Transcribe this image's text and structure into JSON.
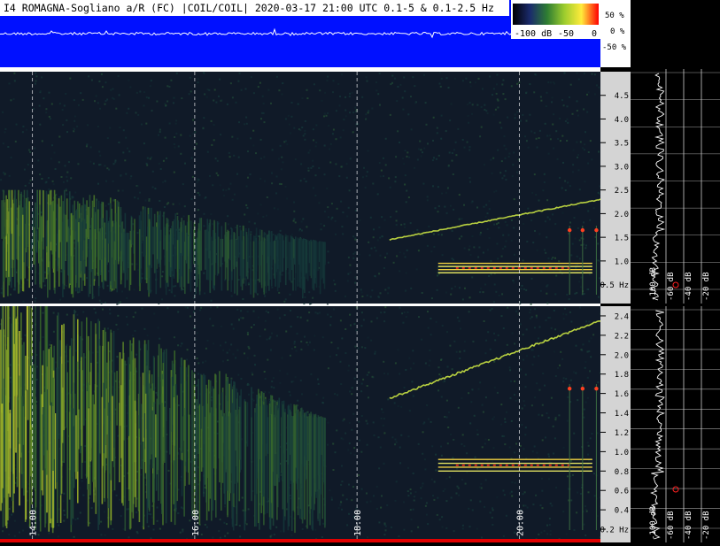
{
  "header": {
    "title": "I4 ROMAGNA-Sogliano a/R (FC) |COIL/COIL| 2020-03-17 21:00 UTC 0.1-5 & 0.1-2.5  Hz"
  },
  "colorbar": {
    "labels": [
      "-100 dB",
      "-50",
      "0"
    ],
    "colors": [
      "#000000",
      "#1a2a6c",
      "#2e7d32",
      "#9ccc2e",
      "#ffeb3b",
      "#ff0000"
    ]
  },
  "waveform_scale": [
    "50 %",
    "0 %",
    "-50 %"
  ],
  "time_axis": {
    "labels": [
      "14:00",
      "16:00",
      "18:00",
      "20:00"
    ],
    "positions_hours": [
      14,
      16,
      18,
      20
    ],
    "start_hour": 13.6,
    "end_hour": 21.0
  },
  "spectrum_axis_labels": [
    "-100 dB",
    "-60 dB",
    "-40 dB",
    "-20 dB"
  ],
  "chart_data": [
    {
      "type": "heatmap",
      "title": "I4 ROMAGNA-Sogliano a/R (FC) |COIL/COIL| 2020-03-17 21:00 UTC 0.1-5 & 0.1-2.5  Hz",
      "xlabel": "",
      "ylabel": "",
      "x_range_hours": [
        13.6,
        21.0
      ],
      "ylim": [
        0.1,
        5.0
      ],
      "y_ticks": [
        0.5,
        1.0,
        1.5,
        2.0,
        2.5,
        3.0,
        3.5,
        4.0,
        4.5
      ],
      "y_tick_labels": [
        "0.5 Hz",
        "1.0",
        "1.5",
        "2.0",
        "2.5",
        "3.0",
        "3.5",
        "4.0",
        "4.5"
      ],
      "features": [
        {
          "kind": "broadband",
          "t": [
            13.6,
            17.6
          ],
          "f": [
            0.3,
            2.5
          ],
          "intensity": 0.7
        },
        {
          "kind": "rising-line",
          "t": [
            18.4,
            21.0
          ],
          "f": [
            1.45,
            2.3
          ]
        },
        {
          "kind": "band",
          "t": [
            19.0,
            20.9
          ],
          "f": [
            0.75,
            0.95
          ]
        },
        {
          "kind": "spots",
          "t": [
            20.6,
            20.9
          ],
          "f": [
            1.65
          ]
        }
      ]
    },
    {
      "type": "heatmap",
      "x_range_hours": [
        13.6,
        21.0
      ],
      "ylim": [
        0.1,
        2.5
      ],
      "y_ticks": [
        0.2,
        0.4,
        0.6,
        0.8,
        1.0,
        1.2,
        1.4,
        1.6,
        1.8,
        2.0,
        2.2,
        2.4
      ],
      "y_tick_labels": [
        "0.2 Hz",
        "0.4",
        "0.6",
        "0.8",
        "1.0",
        "1.2",
        "1.4",
        "1.6",
        "1.8",
        "2.0",
        "2.2",
        "2.4"
      ],
      "features": [
        {
          "kind": "broadband",
          "t": [
            13.6,
            17.6
          ],
          "f": [
            0.2,
            2.5
          ],
          "intensity": 0.85
        },
        {
          "kind": "rising-line",
          "t": [
            18.4,
            21.0
          ],
          "f": [
            1.55,
            2.35
          ]
        },
        {
          "kind": "band",
          "t": [
            19.0,
            20.9
          ],
          "f": [
            0.8,
            0.92
          ]
        },
        {
          "kind": "spots",
          "t": [
            20.6,
            20.9
          ],
          "f": [
            1.65
          ]
        }
      ]
    }
  ]
}
